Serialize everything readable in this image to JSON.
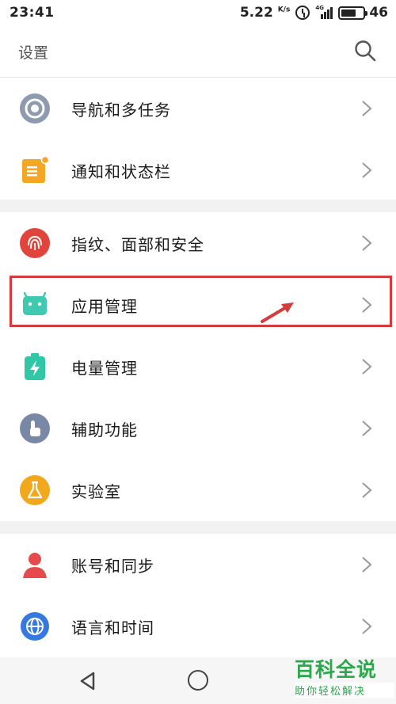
{
  "status_bar": {
    "time": "23:41",
    "speed": "5.22",
    "speed_unit": "K/s",
    "battery": "46"
  },
  "header": {
    "title": "设置",
    "search_icon": "search-icon"
  },
  "groups": [
    {
      "items": [
        {
          "label": "导航和多任务",
          "icon": "navigation-icon",
          "color": "#8e9aaf"
        },
        {
          "label": "通知和状态栏",
          "icon": "notification-icon",
          "color": "#f5a623"
        }
      ]
    },
    {
      "items": [
        {
          "label": "指纹、面部和安全",
          "icon": "fingerprint-icon",
          "color": "#e0443b"
        },
        {
          "label": "应用管理",
          "icon": "android-icon",
          "color": "#3ec9b0"
        },
        {
          "label": "电量管理",
          "icon": "battery-charge-icon",
          "color": "#2fc7a6"
        },
        {
          "label": "辅助功能",
          "icon": "hand-icon",
          "color": "#7a88a8"
        },
        {
          "label": "实验室",
          "icon": "flask-icon",
          "color": "#f2a81c"
        }
      ]
    },
    {
      "items": [
        {
          "label": "账号和同步",
          "icon": "account-icon",
          "color": "#e64a4a"
        },
        {
          "label": "语言和时间",
          "icon": "globe-icon",
          "color": "#3478e0"
        }
      ]
    }
  ],
  "annotation": {
    "highlight_color": "#d63b3b"
  },
  "watermark": {
    "title": "百科全说",
    "subtitle": "助你轻松解决"
  }
}
